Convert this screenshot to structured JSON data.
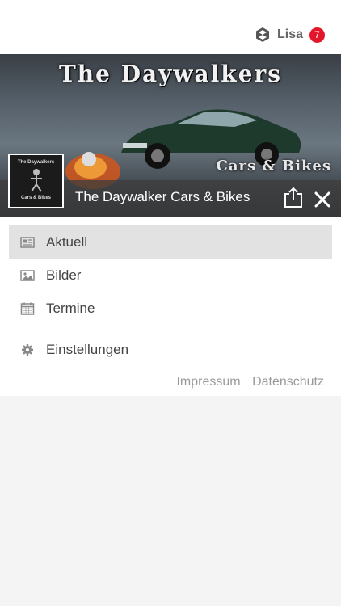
{
  "header": {
    "user_name": "Lisa",
    "notification_count": "7",
    "user_icon": "cube-logo-icon"
  },
  "banner": {
    "image_title": "The Daywalkers",
    "image_subtitle": "Cars & Bikes",
    "page_name": "The Daywalker Cars & Bikes",
    "logo_text_top": "The Daywalkers",
    "logo_text_bottom": "Cars & Bikes",
    "share_icon": "share-icon",
    "close_icon": "close-icon"
  },
  "menu": {
    "items": [
      {
        "label": "Aktuell",
        "icon": "newspaper-icon",
        "active": true
      },
      {
        "label": "Bilder",
        "icon": "image-icon",
        "active": false
      },
      {
        "label": "Termine",
        "icon": "calendar-icon",
        "active": false
      }
    ],
    "settings": {
      "label": "Einstellungen",
      "icon": "gear-icon"
    }
  },
  "footer": {
    "impressum": "Impressum",
    "datenschutz": "Datenschutz"
  },
  "colors": {
    "badge": "#e3152a",
    "active_row": "#e2e2e2",
    "text": "#444444",
    "link": "#9a9a9a"
  }
}
